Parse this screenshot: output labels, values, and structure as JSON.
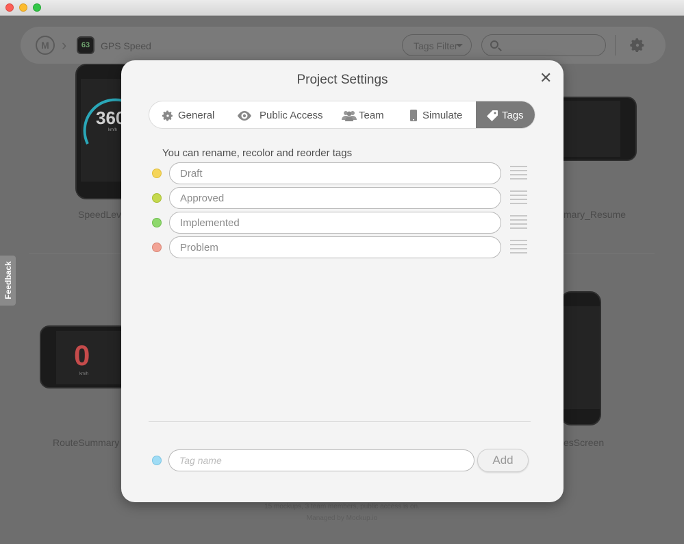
{
  "window": {
    "controls": [
      "close",
      "minimize",
      "maximize"
    ]
  },
  "topbar": {
    "logo_icon": "mockup-logo-icon",
    "app_icon_text": "63",
    "project_name": "GPS Speed",
    "tags_filter_label": "Tags Filter",
    "search_placeholder": "",
    "settings_icon": "gear-icon"
  },
  "background": {
    "screens": [
      {
        "label": "SpeedLev",
        "big_number": "360",
        "unit": "km/h"
      },
      {
        "label": "mary_Resume"
      },
      {
        "label": "RouteSummary",
        "big_number": "0",
        "unit": "km/h"
      },
      {
        "label": "esScreen"
      }
    ],
    "footer_line1": "15 mockups, 3 team members, public access is on.",
    "footer_line2": "Managed by Mockup.io"
  },
  "feedback_label": "Feedback",
  "modal": {
    "title": "Project Settings",
    "close_glyph": "✕",
    "tabs": [
      {
        "label": "General",
        "icon": "gear-icon"
      },
      {
        "label": "Public Access",
        "icon": "eye-icon"
      },
      {
        "label": "Team",
        "icon": "users-icon"
      },
      {
        "label": "Simulate",
        "icon": "phone-icon"
      },
      {
        "label": "Tags",
        "icon": "tag-icon",
        "active": true
      }
    ],
    "hint": "You can rename, recolor and reorder tags",
    "tags": [
      {
        "name": "Draft",
        "color": "#f5d55a"
      },
      {
        "name": "Approved",
        "color": "#c5d94e"
      },
      {
        "name": "Implemented",
        "color": "#8ed86c"
      },
      {
        "name": "Problem",
        "color": "#f2a395"
      }
    ],
    "new_tag": {
      "color": "#9fdcf5",
      "placeholder": "Tag name",
      "value": "",
      "add_label": "Add"
    }
  }
}
